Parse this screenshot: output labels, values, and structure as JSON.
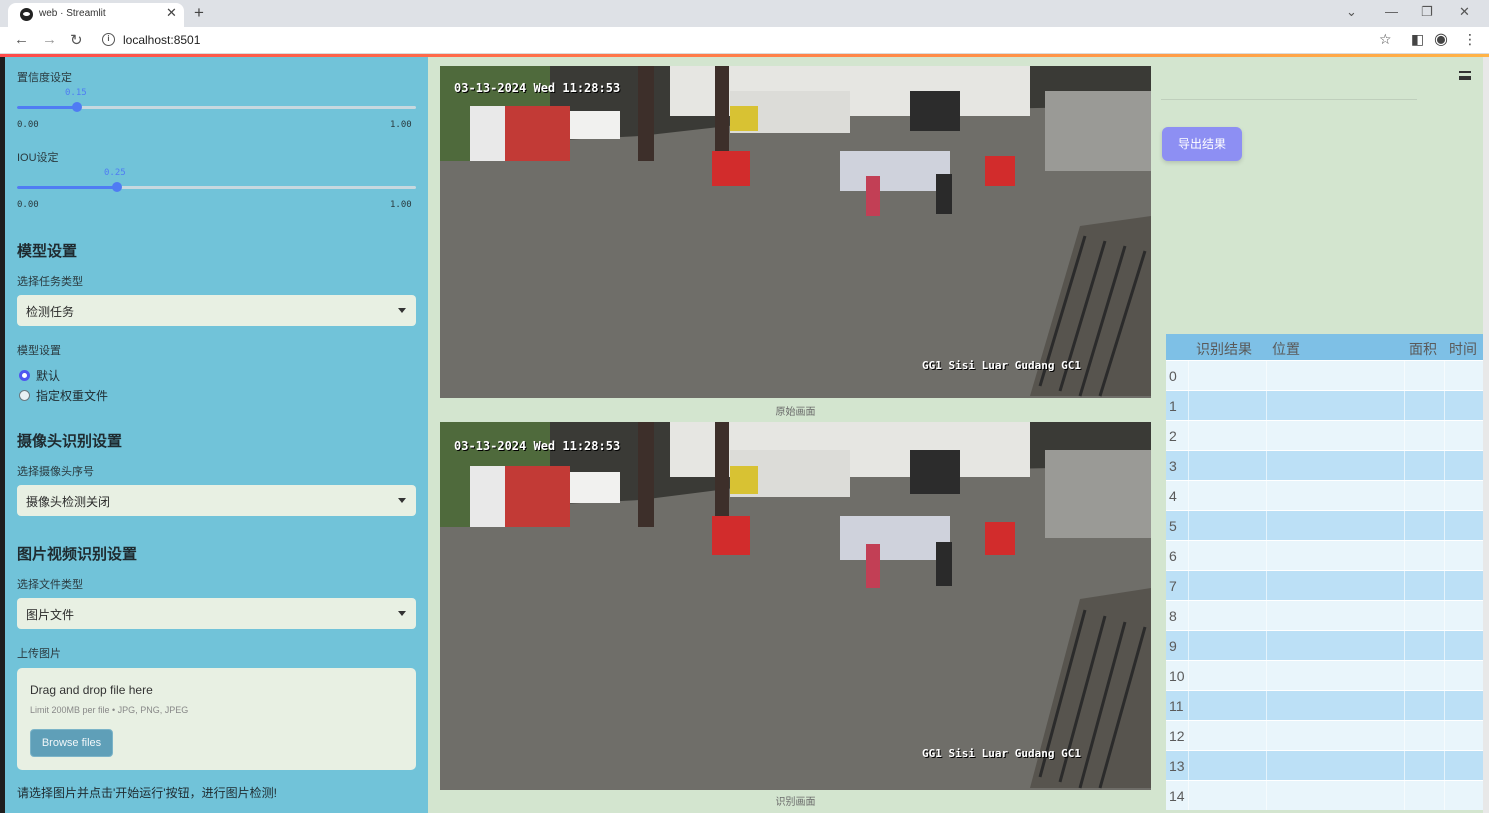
{
  "browser": {
    "tab_title": "web · Streamlit",
    "url": "localhost:8501"
  },
  "sidebar": {
    "confidence": {
      "label": "置信度设定",
      "value": "0.15",
      "value_num": 0.15,
      "min": "0.00",
      "max": "1.00"
    },
    "iou": {
      "label": "IOU设定",
      "value": "0.25",
      "value_num": 0.25,
      "min": "0.00",
      "max": "1.00"
    },
    "model_section": {
      "heading": "模型设置",
      "task_label": "选择任务类型",
      "task_value": "检测任务",
      "weights_label": "模型设置",
      "options": [
        "默认",
        "指定权重文件"
      ],
      "selected": 0
    },
    "camera_section": {
      "heading": "摄像头识别设置",
      "camera_label": "选择摄像头序号",
      "camera_value": "摄像头检测关闭"
    },
    "media_section": {
      "heading": "图片视频识别设置",
      "filetype_label": "选择文件类型",
      "filetype_value": "图片文件",
      "upload_label": "上传图片",
      "drop_text": "Drag and drop file here",
      "limit_text": "Limit 200MB per file • JPG, PNG, JPEG",
      "browse_label": "Browse files"
    },
    "info_text": "请选择图片并点击'开始运行'按钮，进行图片检测!"
  },
  "main": {
    "original_caption": "原始画面",
    "detected_caption": "识别画面",
    "camera_timestamp": "03-13-2024 Wed 11:28:53",
    "camera_name": "GG1 Sisi Luar Gudang GC1",
    "export_label": "导出结果",
    "table": {
      "headers": [
        "识别结果",
        "位置",
        "面积",
        "时间"
      ],
      "row_index": [
        "0",
        "1",
        "2",
        "3",
        "4",
        "5",
        "6",
        "7",
        "8",
        "9",
        "10",
        "11",
        "12",
        "13",
        "14"
      ]
    }
  }
}
